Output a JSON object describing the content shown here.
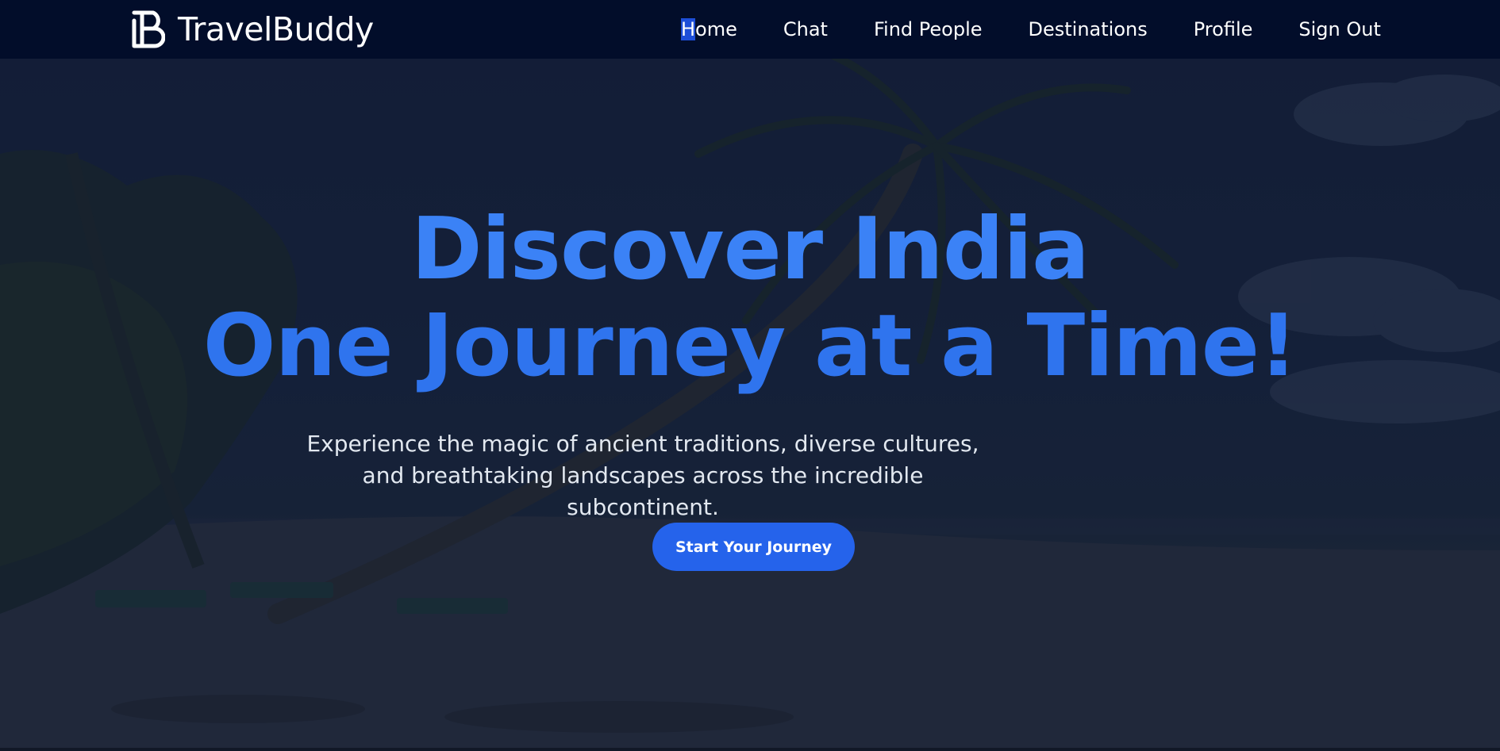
{
  "brand": {
    "name": "TravelBuddy",
    "logo_icon": "tb-monogram-icon"
  },
  "nav": {
    "links": [
      {
        "label": "Home"
      },
      {
        "label": "Chat"
      },
      {
        "label": "Find People"
      },
      {
        "label": "Destinations"
      },
      {
        "label": "Profile"
      },
      {
        "label": "Sign Out"
      }
    ]
  },
  "hero": {
    "title_line1": "Discover India",
    "title_line2": "One Journey at a Time!",
    "subtitle": "Experience the magic of ancient traditions, diverse cultures, and breathtaking landscapes across the incredible subcontinent.",
    "cta_label": "Start Your Journey",
    "background": "beach-with-palm-trees-image"
  },
  "colors": {
    "nav_bg": "#020d2a",
    "accent": "#3b82f6",
    "button": "#2563eb",
    "text": "#ffffff"
  }
}
